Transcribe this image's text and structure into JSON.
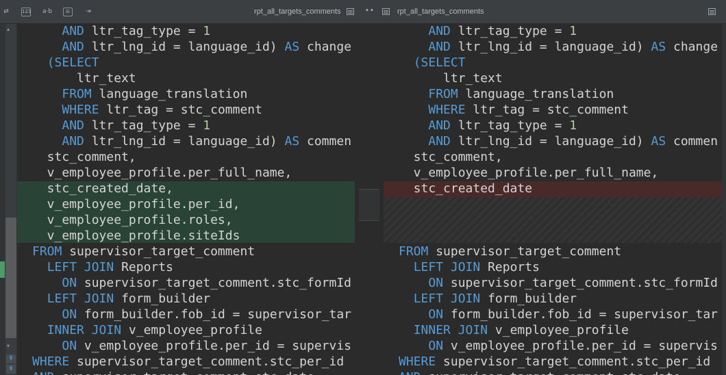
{
  "toolbar": {
    "icons": [
      "compare-icon",
      "line-numbers-icon",
      "whitespace-icon",
      "ignore-case-icon",
      "indent-icon"
    ],
    "icon_glyphs": [
      "⇄",
      "123",
      "a·b",
      "⊟",
      "⇥"
    ],
    "left_title": "rpt_all_targets_comments",
    "right_title": "rpt_all_targets_comments",
    "separator": "••"
  },
  "colors": {
    "keyword": "#569cd6",
    "number": "#b5cea8",
    "added_bg": "#294436",
    "removed_bg": "#4a2929"
  },
  "left_lines": [
    [
      "    ",
      [
        "kw",
        "AND"
      ],
      " ltr_tag_type = ",
      [
        "num",
        "1"
      ]
    ],
    [
      "    ",
      [
        "kw",
        "AND"
      ],
      " ltr_lng_id = language_id) ",
      [
        "kw",
        "AS"
      ],
      " change"
    ],
    [
      "  ",
      [
        "kw",
        "(SELECT"
      ]
    ],
    [
      "      ltr_text"
    ],
    [
      "    ",
      [
        "kw",
        "FROM"
      ],
      " language_translation"
    ],
    [
      "    ",
      [
        "kw",
        "WHERE"
      ],
      " ltr_tag = stc_comment"
    ],
    [
      "    ",
      [
        "kw",
        "AND"
      ],
      " ltr_tag_type = ",
      [
        "num",
        "1"
      ]
    ],
    [
      "    ",
      [
        "kw",
        "AND"
      ],
      " ltr_lng_id = language_id) ",
      [
        "kw",
        "AS"
      ],
      " commen"
    ],
    [
      "  stc_comment,"
    ],
    [
      "  v_employee_profile.per_full_name,"
    ],
    [
      "  stc_created_date,"
    ],
    [
      "  v_employee_profile.per_id,"
    ],
    [
      "  v_employee_profile.roles,"
    ],
    [
      "  v_employee_profile.siteIds"
    ],
    [
      [
        "kw",
        "FROM"
      ],
      " supervisor_target_comment"
    ],
    [
      "  ",
      [
        "kw",
        "LEFT JOIN"
      ],
      " Reports"
    ],
    [
      "    ",
      [
        "kw",
        "ON"
      ],
      " supervisor_target_comment.stc_formId"
    ],
    [
      "  ",
      [
        "kw",
        "LEFT JOIN"
      ],
      " form_builder"
    ],
    [
      "    ",
      [
        "kw",
        "ON"
      ],
      " form_builder.fob_id = supervisor_tar"
    ],
    [
      "  ",
      [
        "kw",
        "INNER JOIN"
      ],
      " v_employee_profile"
    ],
    [
      "    ",
      [
        "kw",
        "ON"
      ],
      " v_employee_profile.per_id = supervis"
    ],
    [
      [
        "kw",
        "WHERE"
      ],
      " supervisor_target_comment.stc_per_id"
    ],
    [
      [
        "kw",
        "AND"
      ],
      " supervisor_target_comment.stc_date"
    ]
  ],
  "right_lines": [
    [
      "    ",
      [
        "kw",
        "AND"
      ],
      " ltr_tag_type = ",
      [
        "num",
        "1"
      ]
    ],
    [
      "    ",
      [
        "kw",
        "AND"
      ],
      " ltr_lng_id = language_id) ",
      [
        "kw",
        "AS"
      ],
      " change"
    ],
    [
      "  ",
      [
        "kw",
        "(SELECT"
      ]
    ],
    [
      "      ltr_text"
    ],
    [
      "    ",
      [
        "kw",
        "FROM"
      ],
      " language_translation"
    ],
    [
      "    ",
      [
        "kw",
        "WHERE"
      ],
      " ltr_tag = stc_comment"
    ],
    [
      "    ",
      [
        "kw",
        "AND"
      ],
      " ltr_tag_type = ",
      [
        "num",
        "1"
      ]
    ],
    [
      "    ",
      [
        "kw",
        "AND"
      ],
      " ltr_lng_id = language_id) ",
      [
        "kw",
        "AS"
      ],
      " commen"
    ],
    [
      "  stc_comment,"
    ],
    [
      "  v_employee_profile.per_full_name,"
    ],
    [
      "  stc_created_date"
    ],
    null,
    null,
    null,
    [
      [
        "kw",
        "FROM"
      ],
      " supervisor_target_comment"
    ],
    [
      "  ",
      [
        "kw",
        "LEFT JOIN"
      ],
      " Reports"
    ],
    [
      "    ",
      [
        "kw",
        "ON"
      ],
      " supervisor_target_comment.stc_formId"
    ],
    [
      "  ",
      [
        "kw",
        "LEFT JOIN"
      ],
      " form_builder"
    ],
    [
      "    ",
      [
        "kw",
        "ON"
      ],
      " form_builder.fob_id = supervisor_tar"
    ],
    [
      "  ",
      [
        "kw",
        "INNER JOIN"
      ],
      " v_employee_profile"
    ],
    [
      "    ",
      [
        "kw",
        "ON"
      ],
      " v_employee_profile.per_id = supervis"
    ],
    [
      [
        "kw",
        "WHERE"
      ],
      " supervisor_target_comment.stc_per_id"
    ],
    [
      [
        "kw",
        "AND"
      ],
      " supervisor_target_comment.stc_date"
    ]
  ]
}
